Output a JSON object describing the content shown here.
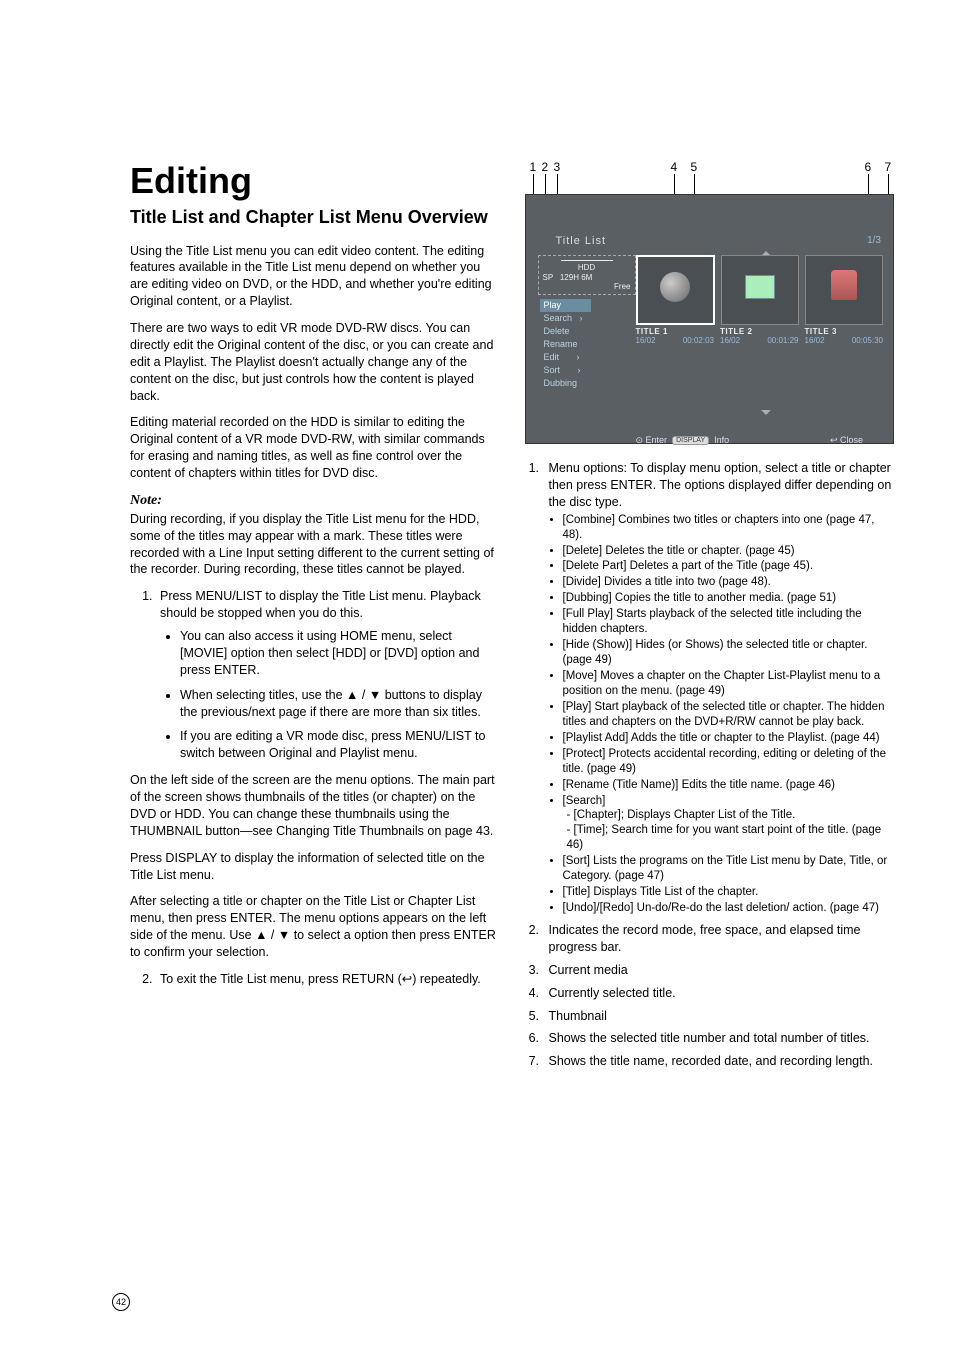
{
  "page_number": "42",
  "left": {
    "h1": "Editing",
    "h2": "Title List and Chapter List Menu Overview",
    "p1": "Using the Title List menu you can edit video content. The editing features available in the Title List menu depend on whether you are editing video on DVD, or the HDD, and whether you're editing Original content, or a Playlist.",
    "p2": "There are two ways to edit VR mode DVD-RW discs. You can directly edit the Original content of the disc, or you can create and edit a Playlist. The Playlist doesn't actually change any of the content on the disc, but just controls how the content is played back.",
    "p3": "Editing material recorded on the HDD is similar to editing the Original content of a VR mode DVD-RW, with similar commands for erasing and naming titles, as well as fine control over the content of chapters within titles for DVD disc.",
    "note_label": "Note:",
    "note_body": "During recording, if you display the Title List menu for the HDD, some of the titles may appear with a mark. These titles were recorded with a Line Input setting different to the current setting of the recorder. During recording, these titles cannot be played.",
    "step1": "Press MENU/LIST to display the Title List menu. Playback should be stopped when you do this.",
    "step1_b1": "You can also access it using HOME menu, select [MOVIE] option then select [HDD] or [DVD] option and press ENTER.",
    "step1_b2": "When selecting titles, use the ▲ / ▼ buttons to display the previous/next page if there are more than six titles.",
    "step1_b3": "If you are editing a VR mode disc, press MENU/LIST to switch between Original and Playlist menu.",
    "p4": "On the left side of the screen are the menu options. The main part of the screen shows thumbnails of the titles (or chapter) on the DVD or HDD. You can change these thumbnails using the THUMBNAIL button—see Changing Title Thumbnails on page 43.",
    "p5": "Press DISPLAY to display the information of selected title on the Title List menu.",
    "p6": "After selecting a title or chapter on the Title List or Chapter List menu, then press ENTER. The menu options appears on the left side of the menu. Use ▲ / ▼ to select a option then press ENTER to confirm your selection.",
    "step2": "To exit the Title List menu, press RETURN (↩) repeatedly."
  },
  "callouts": [
    "1",
    "2",
    "3",
    "4",
    "5",
    "6",
    "7"
  ],
  "ui": {
    "header": "Title List",
    "page": "1/3",
    "hdd": {
      "label": "HDD",
      "mode": "SP",
      "time": "129H 6M",
      "free": "Free"
    },
    "menu": [
      "Play",
      "Search",
      "Delete",
      "Rename",
      "Edit",
      "Sort",
      "Dubbing"
    ],
    "titles": [
      {
        "name": "TITLE 1",
        "date": "16/02",
        "dur": "00:02:03"
      },
      {
        "name": "TITLE 2",
        "date": "16/02",
        "dur": "00:01:29"
      },
      {
        "name": "TITLE 3",
        "date": "16/02",
        "dur": "00:05:30"
      }
    ],
    "footer_left": "⊙ Enter",
    "footer_disp": "DISPLAY",
    "footer_info": "Info",
    "footer_right": "↩ Close"
  },
  "right": {
    "item1": "Menu options: To display menu option, select a title or chapter then press ENTER. The options displayed differ depending on the disc type.",
    "opts": [
      "[Combine] Combines two titles or chapters into one (page 47, 48).",
      "[Delete] Deletes the title or chapter. (page 45)",
      "[Delete Part] Deletes a part of the Title (page 45).",
      "[Divide] Divides a title into two (page 48).",
      "[Dubbing] Copies the title to another media. (page 51)",
      "[Full Play] Starts playback of the selected title including the hidden chapters.",
      "[Hide (Show)] Hides (or Shows) the selected title or chapter. (page 49)",
      "[Move] Moves a chapter on the Chapter List-Playlist menu to a position on the menu. (page 49)",
      "[Play] Start playback of the selected title or chapter. The hidden titles and chapters on the DVD+R/RW cannot be play back.",
      "[Playlist Add] Adds the title or chapter to the Playlist. (page 44)",
      "[Protect] Protects accidental recording, editing or deleting of the title. (page 49)",
      "[Rename (Title Name)] Edits the title name. (page 46)"
    ],
    "search_label": "[Search]",
    "search_a": "- [Chapter]; Displays Chapter List of the Title.",
    "search_b": "- [Time]; Search time for you want start point of the title. (page 46)",
    "opts_tail": [
      "[Sort] Lists the programs on the Title List menu by Date, Title, or Category. (page 47)",
      "[Title] Displays Title List of the chapter.",
      "[Undo]/[Redo] Un-do/Re-do the last deletion/ action. (page 47)"
    ],
    "item2": "Indicates the record mode, free space, and elapsed time progress bar.",
    "item3": "Current media",
    "item4": "Currently selected title.",
    "item5": "Thumbnail",
    "item6": "Shows the selected title number and total number of titles.",
    "item7": "Shows the title name, recorded date, and recording length."
  }
}
